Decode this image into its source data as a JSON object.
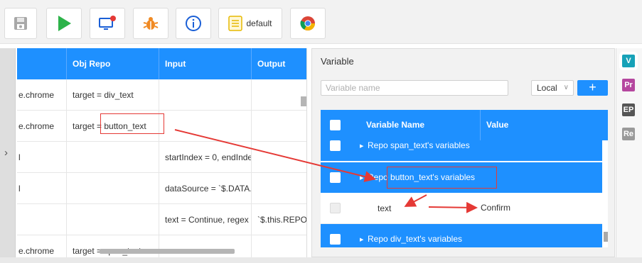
{
  "toolbar": {
    "default_label": "default"
  },
  "steps": {
    "headers": [
      "",
      "Obj Repo",
      "Input",
      "Output"
    ],
    "rows": [
      {
        "keyword": "e.chrome",
        "obj": "target = div_text",
        "input": "",
        "output": ""
      },
      {
        "keyword": "e.chrome",
        "obj": "target = ",
        "obj_highlight": "button_text",
        "input": "",
        "output": ""
      },
      {
        "keyword": "l",
        "obj": "",
        "input": "startIndex = 0, endInde",
        "output": ""
      },
      {
        "keyword": "l",
        "obj": "",
        "input": "dataSource = `$.DATA.C",
        "output": ""
      },
      {
        "keyword": "",
        "obj": "",
        "input": "text = Continue, regex",
        "output": "`$.this.REPO"
      },
      {
        "keyword": "e.chrome",
        "obj": "target = span_text",
        "input": "",
        "output": ""
      }
    ]
  },
  "variable": {
    "title": "Variable",
    "search_placeholder": "Variable name",
    "scope": "Local",
    "add_label": "+",
    "header_name": "Variable Name",
    "header_value": "Value",
    "groups": [
      {
        "label": "Repo span_text's variables"
      },
      {
        "label_prefix": "Repo ",
        "label_highlight": "button_text's variables"
      },
      {
        "label": "Repo div_text's variables"
      }
    ],
    "child": {
      "name": "text"
    }
  },
  "annotation": {
    "confirm_label": "Confirm",
    "color": "#e53935"
  },
  "side_tabs": [
    {
      "label": "V",
      "color": "#17a2b8"
    },
    {
      "label": "Pr",
      "color": "#b5479f"
    },
    {
      "label": "EP",
      "color": "#555555"
    },
    {
      "label": "Re",
      "color": "#9a9a9a"
    }
  ],
  "colors": {
    "accent": "#1e90ff",
    "run_green": "#2db34a",
    "bug_orange": "#f08a24",
    "info_blue": "#1a5fd6"
  }
}
